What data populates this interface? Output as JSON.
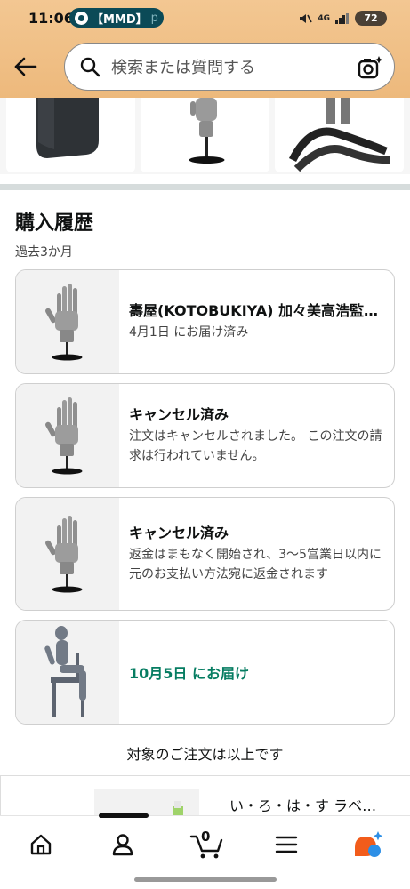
{
  "status_bar": {
    "time": "11:06",
    "notification_label": "【MMD】",
    "notification_more": "p",
    "network": "4G",
    "battery": "72"
  },
  "search": {
    "placeholder": "検索または質問する"
  },
  "order_history": {
    "title": "購入履歴",
    "subtitle": "過去3か月",
    "orders": [
      {
        "title": "壽屋(KOTOBUKIYA) 加々美高浩監修 アーティザン…",
        "status": "4月1日 にお届け済み",
        "thumb": "wooden-hand-figure"
      },
      {
        "title": "キャンセル済み",
        "status": "注文はキャンセルされました。 この注文の請求は行われていません。",
        "thumb": "wooden-hand-figure"
      },
      {
        "title": "キャンセル済み",
        "status": "返金はまもなく開始され、3〜5営業日以内に元のお支払い方法宛に返金されます",
        "thumb": "wooden-hand-figure"
      },
      {
        "delivery": "10月5日 にお届け",
        "thumb": "seated-figure-on-chair"
      }
    ],
    "end_text": "対象のご注文は以上です"
  },
  "recommendation": {
    "title": "い・ろ・は・す ラベ…"
  },
  "bottom_nav": {
    "items": [
      "home-icon",
      "account-icon",
      "cart-icon",
      "menu-icon",
      "ai-assistant-icon"
    ],
    "cart_count": "0"
  },
  "colors": {
    "header": "#f0c088",
    "accent_green": "#067d62",
    "notif_pill": "#0b4a57"
  }
}
